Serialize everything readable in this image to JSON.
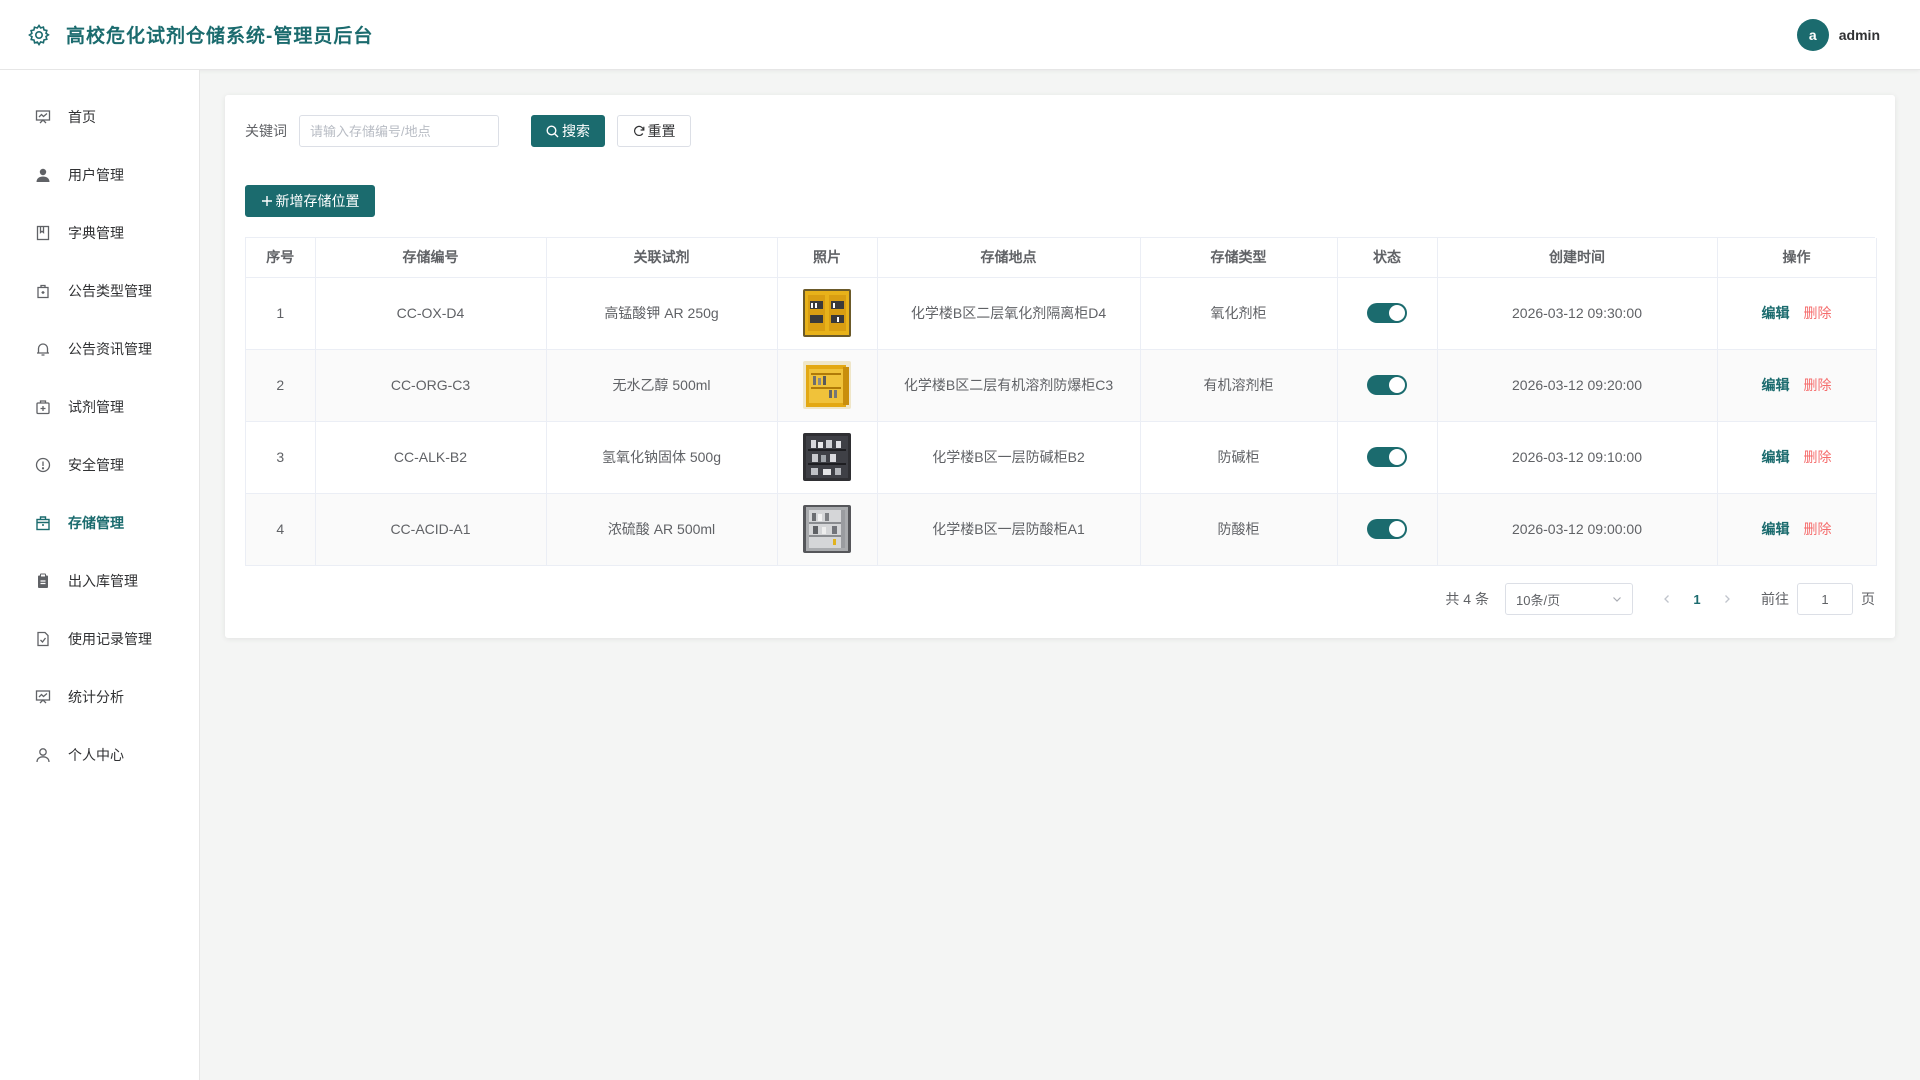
{
  "header": {
    "title": "高校危化试剂仓储系统-管理员后台",
    "avatar_letter": "a",
    "username": "admin",
    "accent_color": "#1b6b6e"
  },
  "sidebar": {
    "items": [
      {
        "label": "首页",
        "icon": "home-chart-icon"
      },
      {
        "label": "用户管理",
        "icon": "user-icon"
      },
      {
        "label": "字典管理",
        "icon": "dictionary-icon"
      },
      {
        "label": "公告类型管理",
        "icon": "notice-type-icon"
      },
      {
        "label": "公告资讯管理",
        "icon": "bell-icon"
      },
      {
        "label": "试剂管理",
        "icon": "reagent-icon"
      },
      {
        "label": "安全管理",
        "icon": "warning-circle-icon"
      },
      {
        "label": "存储管理",
        "icon": "storage-icon",
        "active": true
      },
      {
        "label": "出入库管理",
        "icon": "clipboard-icon"
      },
      {
        "label": "使用记录管理",
        "icon": "record-icon"
      },
      {
        "label": "统计分析",
        "icon": "stats-icon"
      },
      {
        "label": "个人中心",
        "icon": "profile-icon"
      }
    ]
  },
  "search": {
    "label": "关键词",
    "placeholder": "请输入存储编号/地点",
    "value": "",
    "search_label": "搜索",
    "reset_label": "重置"
  },
  "toolbar": {
    "add_label": "新增存储位置"
  },
  "table": {
    "columns": [
      "序号",
      "存储编号",
      "关联试剂",
      "照片",
      "存储地点",
      "存储类型",
      "状态",
      "创建时间",
      "操作"
    ],
    "rows": [
      {
        "index": "1",
        "code": "CC-OX-D4",
        "reagent": "高锰酸钾 AR 250g",
        "location": "化学楼B区二层氧化剂隔离柜D4",
        "type": "氧化剂柜",
        "enabled": true,
        "created": "2026-03-12 09:30:00",
        "photo": "yellow-cabinet"
      },
      {
        "index": "2",
        "code": "CC-ORG-C3",
        "reagent": "无水乙醇 500ml",
        "location": "化学楼B区二层有机溶剂防爆柜C3",
        "type": "有机溶剂柜",
        "enabled": true,
        "created": "2026-03-12 09:20:00",
        "photo": "yellow-cabinet-open"
      },
      {
        "index": "3",
        "code": "CC-ALK-B2",
        "reagent": "氢氧化钠固体 500g",
        "location": "化学楼B区一层防碱柜B2",
        "type": "防碱柜",
        "enabled": true,
        "created": "2026-03-12 09:10:00",
        "photo": "dark-shelf"
      },
      {
        "index": "4",
        "code": "CC-ACID-A1",
        "reagent": "浓硫酸 AR 500ml",
        "location": "化学楼B区一层防酸柜A1",
        "type": "防酸柜",
        "enabled": true,
        "created": "2026-03-12 09:00:00",
        "photo": "grey-cabinet"
      }
    ],
    "edit_label": "编辑",
    "delete_label": "删除"
  },
  "pagination": {
    "total_text": "共 4 条",
    "page_size": "10条/页",
    "current_page": "1",
    "goto_prefix": "前往",
    "goto_value": "1",
    "goto_suffix": "页"
  }
}
